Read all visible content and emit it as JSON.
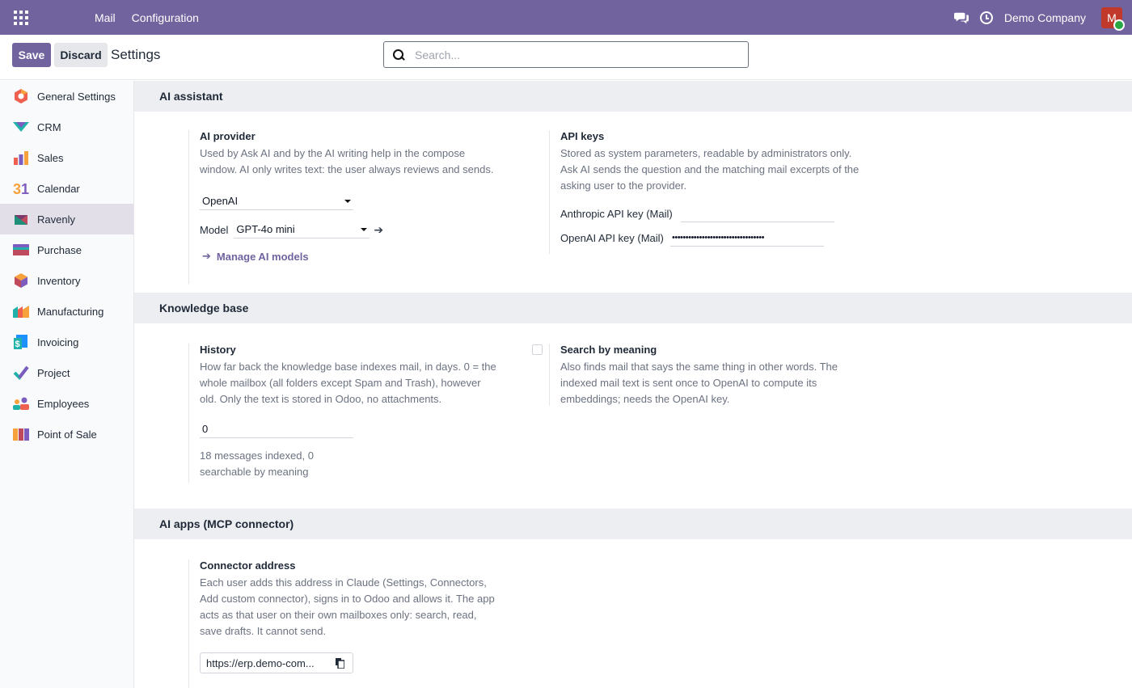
{
  "navbar": {
    "menu": [
      "Mail",
      "Configuration"
    ],
    "company": "Demo Company",
    "avatar_letter": "M",
    "bg_color": "#71639e"
  },
  "control": {
    "save_label": "Save",
    "discard_label": "Discard",
    "breadcrumb": "Settings",
    "search_placeholder": "Search..."
  },
  "sidebar": {
    "items": [
      {
        "label": "General Settings",
        "icon": "general-settings-icon"
      },
      {
        "label": "CRM",
        "icon": "crm-icon"
      },
      {
        "label": "Sales",
        "icon": "sales-icon"
      },
      {
        "label": "Calendar",
        "icon": "calendar-icon"
      },
      {
        "label": "Ravenly",
        "icon": "ravenly-icon",
        "active": true
      },
      {
        "label": "Purchase",
        "icon": "purchase-icon"
      },
      {
        "label": "Inventory",
        "icon": "inventory-icon"
      },
      {
        "label": "Manufacturing",
        "icon": "manufacturing-icon"
      },
      {
        "label": "Invoicing",
        "icon": "invoicing-icon"
      },
      {
        "label": "Project",
        "icon": "project-icon"
      },
      {
        "label": "Employees",
        "icon": "employees-icon"
      },
      {
        "label": "Point of Sale",
        "icon": "point-of-sale-icon"
      }
    ]
  },
  "ai_assistant": {
    "heading": "AI assistant",
    "provider": {
      "title": "AI provider",
      "desc": "Used by Ask AI and by the AI writing help in the compose window. AI only writes text: the user always reviews and sends.",
      "value": "OpenAI",
      "model_label": "Model",
      "model_value": "GPT-4o mini",
      "manage_link": "Manage AI models"
    },
    "api_keys": {
      "title": "API keys",
      "desc": "Stored as system parameters, readable by administrators only. Ask AI sends the question and the matching mail excerpts of the asking user to the provider.",
      "anthropic_label": "Anthropic API key (Mail)",
      "anthropic_value": "",
      "openai_label": "OpenAI API key (Mail)",
      "openai_value": "••••••••••••••••••••••••••••••••••"
    }
  },
  "knowledge_base": {
    "heading": "Knowledge base",
    "history": {
      "title": "History",
      "desc": "How far back the knowledge base indexes mail, in days. 0 = the whole mailbox (all folders except Spam and Trash), however old. Only the text is stored in Odoo, no attachments.",
      "value": "0",
      "status": "18 messages indexed, 0 searchable by meaning"
    },
    "meaning": {
      "title": "Search by meaning",
      "desc": "Also finds mail that says the same thing in other words. The indexed mail text is sent once to OpenAI to compute its embeddings; needs the OpenAI key."
    }
  },
  "mcp": {
    "heading": "AI apps (MCP connector)",
    "connector": {
      "title": "Connector address",
      "desc": "Each user adds this address in Claude (Settings, Connectors, Add custom connector), signs in to Odoo and allows it. The app acts as that user on their own mailboxes only: search, read, save drafts. It cannot send.",
      "address": "https://erp.demo-com..."
    }
  }
}
